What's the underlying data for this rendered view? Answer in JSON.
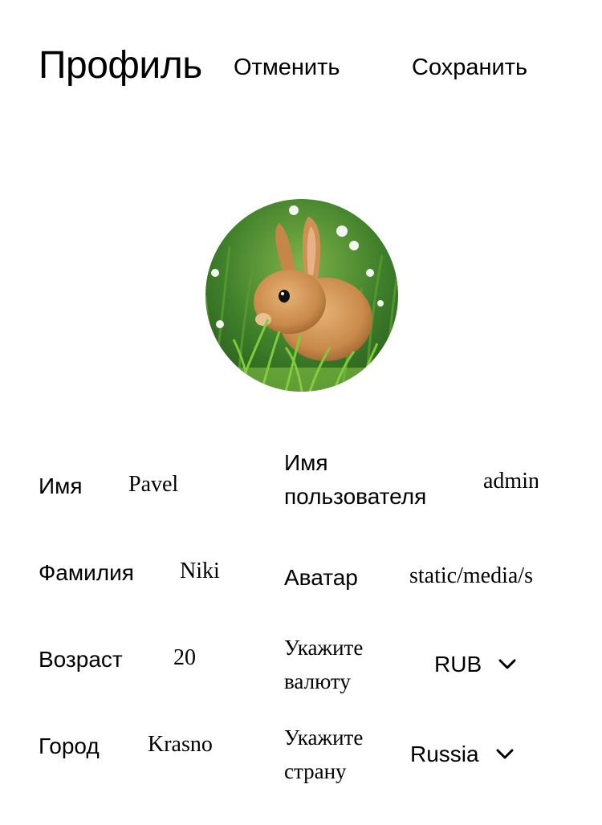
{
  "header": {
    "title": "Профиль",
    "cancel_label": "Отменить",
    "save_label": "Сохранить"
  },
  "avatar": {
    "icon": "rabbit-photo"
  },
  "form": {
    "first_name": {
      "label": "Имя",
      "value": "Pavel"
    },
    "last_name": {
      "label": "Фамилия",
      "value": "Niki"
    },
    "age": {
      "label": "Возраст",
      "value": "20"
    },
    "city": {
      "label": "Город",
      "value": "Krasno"
    },
    "username": {
      "label_line1": "Имя",
      "label_line2": "пользователя",
      "value": "admin"
    },
    "avatar_path": {
      "label": "Аватар",
      "value": "static/media/s"
    },
    "currency": {
      "label_line1": "Укажите",
      "label_line2": "валюту",
      "value": "RUB"
    },
    "country": {
      "label_line1": "Укажите",
      "label_line2": "страну",
      "value": "Russia"
    }
  }
}
